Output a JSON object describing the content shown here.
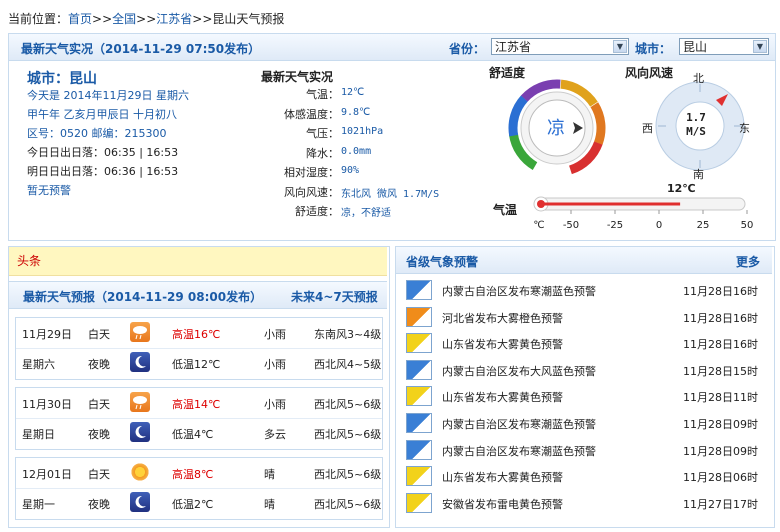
{
  "breadcrumb": {
    "prefix": "当前位置：",
    "home": "首页",
    "sep": ">>",
    "country": "全国",
    "province": "江苏省",
    "page": "昆山天气预报"
  },
  "header": {
    "title": "最新天气实况（2014-11-29 07:50发布）",
    "province_label": "省份：",
    "province_value": "江苏省",
    "city_label": "城市：",
    "city_value": "昆山"
  },
  "city": {
    "name": "城市：昆山",
    "today": "今天是 2014年11月29日 星期六",
    "lunar": "甲午年 乙亥月甲辰日 十月初八",
    "codes": "区号：0520  邮编：215300",
    "sun_today": "今日日出日落：06:35 | 16:53",
    "sun_tomorrow": "明日日出日落：06:36 | 16:53",
    "warning": "暂无预警"
  },
  "observation": {
    "title": "最新天气实况",
    "rows": [
      {
        "label": "气温：",
        "value": "12℃"
      },
      {
        "label": "体感温度：",
        "value": "9.8℃"
      },
      {
        "label": "气压：",
        "value": "1021hPa"
      },
      {
        "label": "降水：",
        "value": "0.0mm"
      },
      {
        "label": "相对湿度：",
        "value": "90%"
      },
      {
        "label": "风向风速：",
        "value": "东北风 微风 1.7M/S"
      },
      {
        "label": "舒适度：",
        "value": "凉，不舒适"
      }
    ]
  },
  "comfort": {
    "title": "舒适度",
    "value": "凉"
  },
  "wind": {
    "title": "风向风速",
    "speed": "1.7",
    "unit": "M/S",
    "n": "北",
    "s": "南",
    "e": "东",
    "w": "西"
  },
  "thermo": {
    "label": "气温",
    "current": "12℃",
    "ticks": [
      "℃",
      "-50",
      "-25",
      "0",
      "25",
      "50"
    ],
    "value": 12
  },
  "toutiao": {
    "label": "头条"
  },
  "forecast": {
    "title": "最新天气预报（2014-11-29 08:00发布）",
    "link": "未来4~7天预报",
    "days": [
      {
        "date": "11月29日",
        "weekday": "星期六",
        "day": {
          "period": "白天",
          "temp": "高温16℃",
          "weather": "小雨",
          "wind": "东南风3~4级",
          "icon": "rain-icon"
        },
        "night": {
          "period": "夜晚",
          "temp": "低温12℃",
          "weather": "小雨",
          "wind": "西北风4~5级",
          "icon": "rain-night-icon"
        }
      },
      {
        "date": "11月30日",
        "weekday": "星期日",
        "day": {
          "period": "白天",
          "temp": "高温14℃",
          "weather": "小雨",
          "wind": "西北风5~6级",
          "icon": "rain-icon"
        },
        "night": {
          "period": "夜晚",
          "temp": "低温4℃",
          "weather": "多云",
          "wind": "西北风5~6级",
          "icon": "cloudy-night-icon"
        }
      },
      {
        "date": "12月01日",
        "weekday": "星期一",
        "day": {
          "period": "白天",
          "temp": "高温8℃",
          "weather": "晴",
          "wind": "西北风5~6级",
          "icon": "sun-icon"
        },
        "night": {
          "period": "夜晚",
          "temp": "低温2℃",
          "weather": "晴",
          "wind": "西北风5~6级",
          "icon": "moon-icon"
        }
      }
    ]
  },
  "warnings": {
    "title": "省级气象预警",
    "more": "更多",
    "items": [
      {
        "text": "内蒙古自治区发布寒潮蓝色预警",
        "time": "11月28日16时",
        "color": "#3a7fd5"
      },
      {
        "text": "河北省发布大雾橙色预警",
        "time": "11月28日16时",
        "color": "#f08c1a"
      },
      {
        "text": "山东省发布大雾黄色预警",
        "time": "11月28日16时",
        "color": "#f2d21a"
      },
      {
        "text": "内蒙古自治区发布大风蓝色预警",
        "time": "11月28日15时",
        "color": "#3a7fd5"
      },
      {
        "text": "山东省发布大雾黄色预警",
        "time": "11月28日11时",
        "color": "#f2d21a"
      },
      {
        "text": "内蒙古自治区发布寒潮蓝色预警",
        "time": "11月28日09时",
        "color": "#3a7fd5"
      },
      {
        "text": "内蒙古自治区发布寒潮蓝色预警",
        "time": "11月28日09时",
        "color": "#3a7fd5"
      },
      {
        "text": "山东省发布大雾黄色预警",
        "time": "11月28日06时",
        "color": "#f2d21a"
      },
      {
        "text": "安徽省发布雷电黄色预警",
        "time": "11月27日17时",
        "color": "#f2d21a"
      }
    ]
  }
}
